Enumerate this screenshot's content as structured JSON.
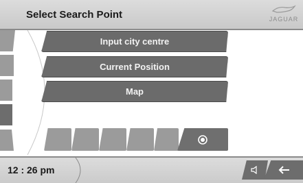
{
  "header": {
    "title": "Select Search Point",
    "logo_text": "JAGUAR"
  },
  "menu": {
    "items": [
      {
        "label": "Input city centre"
      },
      {
        "label": "Current Position"
      },
      {
        "label": "Map"
      }
    ]
  },
  "bottom_slots": {
    "selected_icon": "circle-icon"
  },
  "status": {
    "clock": "12 : 26 pm",
    "volume_icon": "speaker-icon",
    "back_icon": "back-arrow-icon"
  },
  "colors": {
    "button": "#6b6b6b",
    "button_light": "#9b9b9b",
    "bar": "#d3d3d3"
  }
}
